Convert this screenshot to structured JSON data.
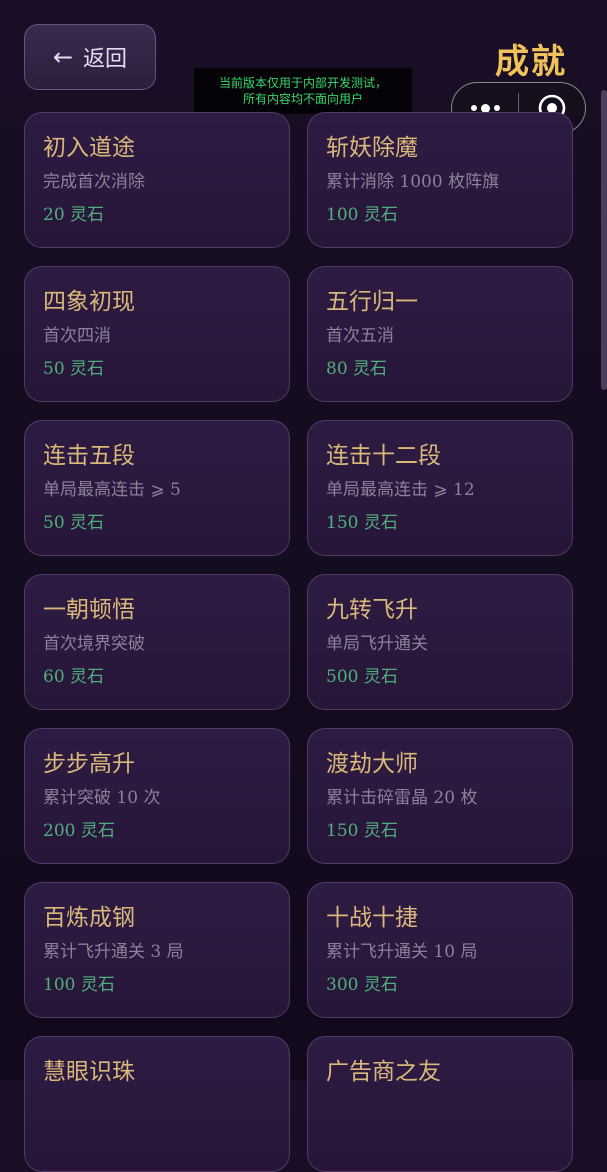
{
  "header": {
    "back_arrow": "←",
    "back_label": "返回",
    "title": "成就"
  },
  "dev_notice": {
    "line1": "当前版本仅用于内部开发测试，",
    "line2": "所有内容均不面向用户"
  },
  "capsule": {
    "more_icon": "more-dots-icon",
    "close_icon": "target-close-icon"
  },
  "colors": {
    "title_gold": "#f0c25a",
    "card_title": "#d9b87a",
    "reward_green": "#4fb07c",
    "notice_green": "#38d86a"
  },
  "achievements": [
    {
      "title": "初入道途",
      "desc": "完成首次消除",
      "reward": "20 灵石"
    },
    {
      "title": "斩妖除魔",
      "desc": "累计消除 1000 枚阵旗",
      "reward": "100 灵石"
    },
    {
      "title": "四象初现",
      "desc": "首次四消",
      "reward": "50 灵石"
    },
    {
      "title": "五行归一",
      "desc": "首次五消",
      "reward": "80 灵石"
    },
    {
      "title": "连击五段",
      "desc": "单局最高连击 ⩾ 5",
      "reward": "50 灵石"
    },
    {
      "title": "连击十二段",
      "desc": "单局最高连击 ⩾ 12",
      "reward": "150 灵石"
    },
    {
      "title": "一朝顿悟",
      "desc": "首次境界突破",
      "reward": "60 灵石"
    },
    {
      "title": "九转飞升",
      "desc": "单局飞升通关",
      "reward": "500 灵石"
    },
    {
      "title": "步步高升",
      "desc": "累计突破 10 次",
      "reward": "200 灵石"
    },
    {
      "title": "渡劫大师",
      "desc": "累计击碎雷晶 20 枚",
      "reward": "150 灵石"
    },
    {
      "title": "百炼成钢",
      "desc": "累计飞升通关 3 局",
      "reward": "100 灵石"
    },
    {
      "title": "十战十捷",
      "desc": "累计飞升通关 10 局",
      "reward": "300 灵石"
    },
    {
      "title": "慧眼识珠",
      "desc": "",
      "reward": ""
    },
    {
      "title": "广告商之友",
      "desc": "",
      "reward": ""
    }
  ]
}
